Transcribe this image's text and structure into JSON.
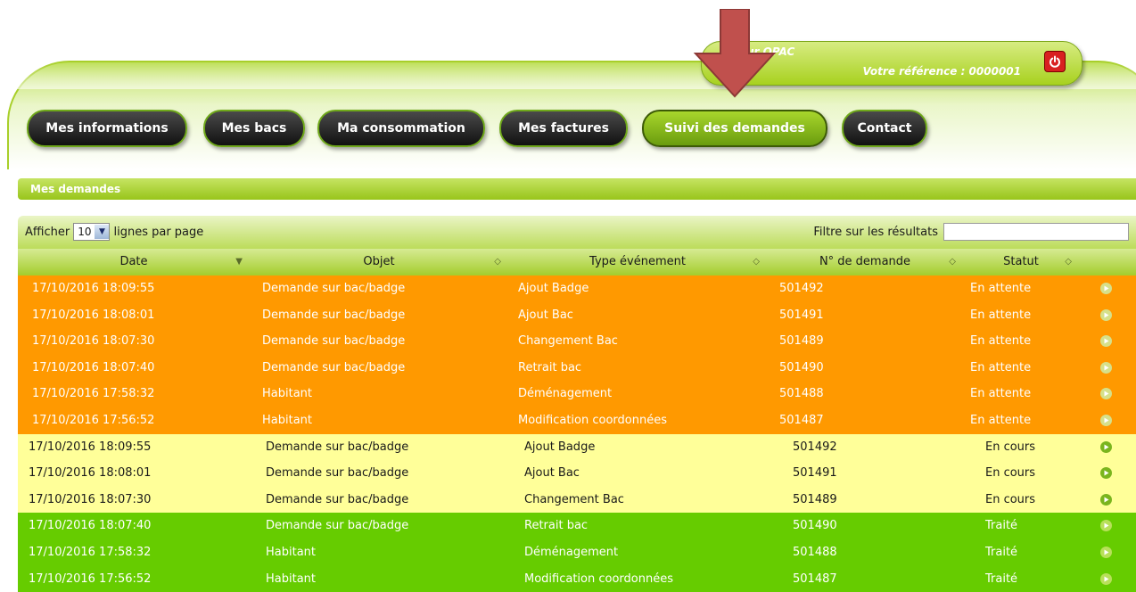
{
  "header": {
    "user_name": "ur OPAC",
    "reference": "Votre référence : 0000001",
    "power_icon": "power-icon",
    "arrow_color": "#c0504d"
  },
  "nav": {
    "items": [
      {
        "label": "Mes informations"
      },
      {
        "label": "Mes bacs"
      },
      {
        "label": "Ma consommation"
      },
      {
        "label": "Mes factures"
      },
      {
        "label": "Suivi des demandes",
        "active": true
      },
      {
        "label": "Contact"
      }
    ]
  },
  "section": {
    "title": "Mes demandes"
  },
  "toolbar": {
    "show_label": "Afficher",
    "page_size": "10",
    "per_page_label": "lignes par page",
    "filter_label": "Filtre sur les résultats",
    "filter_value": ""
  },
  "table": {
    "columns": [
      "Date",
      "Objet",
      "Type événement",
      "N° de demande",
      "Statut"
    ],
    "rows": [
      {
        "date": "17/10/2016 18:09:55",
        "objet": "Demande sur bac/badge",
        "type": "Ajout Badge",
        "numero": "501492",
        "statut": "En attente"
      },
      {
        "date": "17/10/2016 18:08:01",
        "objet": "Demande sur bac/badge",
        "type": "Ajout Bac",
        "numero": "501491",
        "statut": "En attente"
      },
      {
        "date": "17/10/2016 18:07:30",
        "objet": "Demande sur bac/badge",
        "type": "Changement Bac",
        "numero": "501489",
        "statut": "En attente"
      },
      {
        "date": "17/10/2016 18:07:40",
        "objet": "Demande sur bac/badge",
        "type": "Retrait bac",
        "numero": "501490",
        "statut": "En attente"
      },
      {
        "date": "17/10/2016 17:58:32",
        "objet": "Habitant",
        "type": "Déménagement",
        "numero": "501488",
        "statut": "En attente"
      },
      {
        "date": "17/10/2016 17:56:52",
        "objet": "Habitant",
        "type": "Modification coordonnées",
        "numero": "501487",
        "statut": "En attente"
      },
      {
        "date": "17/10/2016 18:09:55",
        "objet": "Demande sur bac/badge",
        "type": "Ajout Badge",
        "numero": "501492",
        "statut": "En cours"
      },
      {
        "date": "17/10/2016 18:08:01",
        "objet": "Demande sur bac/badge",
        "type": "Ajout Bac",
        "numero": "501491",
        "statut": "En cours"
      },
      {
        "date": "17/10/2016 18:07:30",
        "objet": "Demande sur bac/badge",
        "type": "Changement Bac",
        "numero": "501489",
        "statut": "En cours"
      },
      {
        "date": "17/10/2016 18:07:40",
        "objet": "Demande sur bac/badge",
        "type": "Retrait bac",
        "numero": "501490",
        "statut": "Traité"
      },
      {
        "date": "17/10/2016 17:58:32",
        "objet": "Habitant",
        "type": "Déménagement",
        "numero": "501488",
        "statut": "Traité"
      },
      {
        "date": "17/10/2016 17:56:52",
        "objet": "Habitant",
        "type": "Modification coordonnées",
        "numero": "501487",
        "statut": "Traité"
      }
    ]
  },
  "status_colors": {
    "En attente": "#ff9900",
    "En cours": "#ffff99",
    "Traité": "#66cc00"
  }
}
